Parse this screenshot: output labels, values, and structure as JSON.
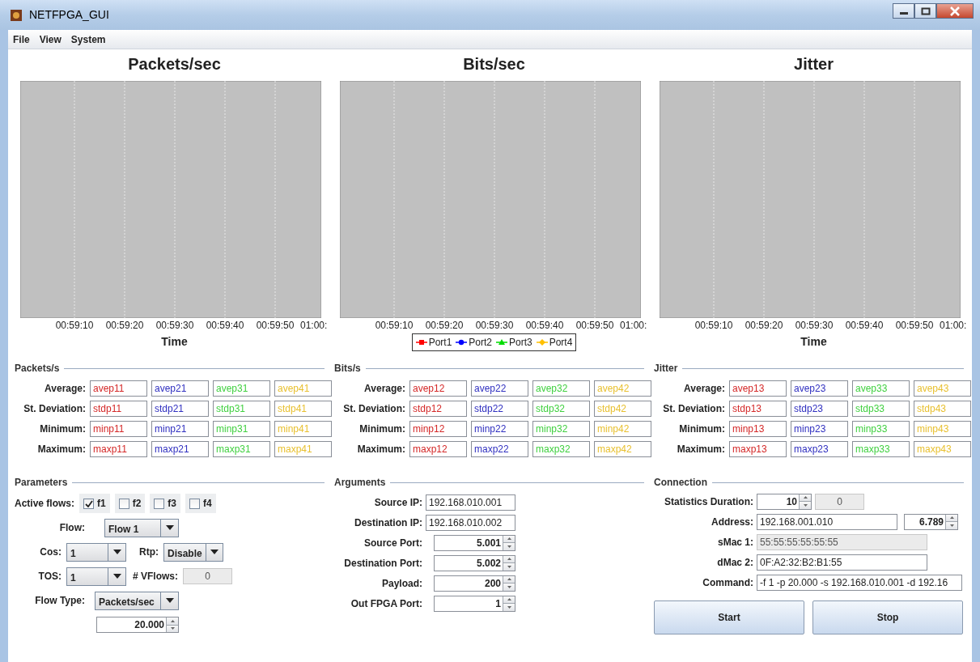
{
  "window": {
    "title": "NETFPGA_GUI"
  },
  "menu": [
    "File",
    "View",
    "System"
  ],
  "charts": [
    {
      "title": "Packets/sec",
      "ticks": [
        "00:59:10",
        "00:59:20",
        "00:59:30",
        "00:59:40",
        "00:59:50",
        "01:00:"
      ],
      "xlabel": "Time"
    },
    {
      "title": "Bits/sec",
      "ticks": [
        "00:59:10",
        "00:59:20",
        "00:59:30",
        "00:59:40",
        "00:59:50",
        "01:00:"
      ],
      "legend": [
        {
          "label": "Port1",
          "color": "#ff0000",
          "kind": "square"
        },
        {
          "label": "Port2",
          "color": "#0000ff",
          "kind": "circle"
        },
        {
          "label": "Port3",
          "color": "#00dd00",
          "kind": "triangle"
        },
        {
          "label": "Port4",
          "color": "#ffc000",
          "kind": "diamond"
        }
      ]
    },
    {
      "title": "Jitter",
      "ticks": [
        "00:59:10",
        "00:59:20",
        "00:59:30",
        "00:59:40",
        "00:59:50",
        "01:00:"
      ],
      "xlabel": "Time"
    }
  ],
  "stats": [
    {
      "title": "Packets/s",
      "rows": [
        {
          "label": "Average:",
          "cells": [
            {
              "text": "avep11",
              "color": "#d42828"
            },
            {
              "text": "avep21",
              "color": "#3030c0"
            },
            {
              "text": "avep31",
              "color": "#40d040"
            },
            {
              "text": "avep41",
              "color": "#e8c030"
            }
          ]
        },
        {
          "label": "St. Deviation:",
          "cells": [
            {
              "text": "stdp11",
              "color": "#d42828"
            },
            {
              "text": "stdp21",
              "color": "#3030c0"
            },
            {
              "text": "stdp31",
              "color": "#40d040"
            },
            {
              "text": "stdp41",
              "color": "#e8c030"
            }
          ]
        },
        {
          "label": "Minimum:",
          "cells": [
            {
              "text": "minp11",
              "color": "#d42828"
            },
            {
              "text": "minp21",
              "color": "#3030c0"
            },
            {
              "text": "minp31",
              "color": "#40d040"
            },
            {
              "text": "minp41",
              "color": "#e8c030"
            }
          ]
        },
        {
          "label": "Maximum:",
          "cells": [
            {
              "text": "maxp11",
              "color": "#d42828"
            },
            {
              "text": "maxp21",
              "color": "#3030c0"
            },
            {
              "text": "maxp31",
              "color": "#40d040"
            },
            {
              "text": "maxp41",
              "color": "#e8c030"
            }
          ]
        }
      ]
    },
    {
      "title": "Bits/s",
      "rows": [
        {
          "label": "Average:",
          "cells": [
            {
              "text": "avep12",
              "color": "#d42828"
            },
            {
              "text": "avep22",
              "color": "#3030c0"
            },
            {
              "text": "avep32",
              "color": "#40d040"
            },
            {
              "text": "avep42",
              "color": "#e8c030"
            }
          ]
        },
        {
          "label": "St. Deviation:",
          "cells": [
            {
              "text": "stdp12",
              "color": "#d42828"
            },
            {
              "text": "stdp22",
              "color": "#3030c0"
            },
            {
              "text": "stdp32",
              "color": "#40d040"
            },
            {
              "text": "stdp42",
              "color": "#e8c030"
            }
          ]
        },
        {
          "label": "Minimum:",
          "cells": [
            {
              "text": "minp12",
              "color": "#d42828"
            },
            {
              "text": "minp22",
              "color": "#3030c0"
            },
            {
              "text": "minp32",
              "color": "#40d040"
            },
            {
              "text": "minp42",
              "color": "#e8c030"
            }
          ]
        },
        {
          "label": "Maximum:",
          "cells": [
            {
              "text": "maxp12",
              "color": "#d42828"
            },
            {
              "text": "maxp22",
              "color": "#3030c0"
            },
            {
              "text": "maxp32",
              "color": "#40d040"
            },
            {
              "text": "maxp42",
              "color": "#e8c030"
            }
          ]
        }
      ]
    },
    {
      "title": "Jitter",
      "rows": [
        {
          "label": "Average:",
          "cells": [
            {
              "text": "avep13",
              "color": "#d42828"
            },
            {
              "text": "avep23",
              "color": "#3030c0"
            },
            {
              "text": "avep33",
              "color": "#40d040"
            },
            {
              "text": "avep43",
              "color": "#e8c030"
            }
          ]
        },
        {
          "label": "St. Deviation:",
          "cells": [
            {
              "text": "stdp13",
              "color": "#d42828"
            },
            {
              "text": "stdp23",
              "color": "#3030c0"
            },
            {
              "text": "stdp33",
              "color": "#40d040"
            },
            {
              "text": "stdp43",
              "color": "#e8c030"
            }
          ]
        },
        {
          "label": "Minimum:",
          "cells": [
            {
              "text": "minp13",
              "color": "#d42828"
            },
            {
              "text": "minp23",
              "color": "#3030c0"
            },
            {
              "text": "minp33",
              "color": "#40d040"
            },
            {
              "text": "minp43",
              "color": "#e8c030"
            }
          ]
        },
        {
          "label": "Maximum:",
          "cells": [
            {
              "text": "maxp13",
              "color": "#d42828"
            },
            {
              "text": "maxp23",
              "color": "#3030c0"
            },
            {
              "text": "maxp33",
              "color": "#40d040"
            },
            {
              "text": "maxp43",
              "color": "#e8c030"
            }
          ]
        }
      ]
    }
  ],
  "parameters": {
    "title": "Parameters",
    "active_flows_label": "Active flows:",
    "flows": [
      {
        "label": "f1",
        "checked": true
      },
      {
        "label": "f2",
        "checked": false
      },
      {
        "label": "f3",
        "checked": false
      },
      {
        "label": "f4",
        "checked": false
      }
    ],
    "flow": {
      "label": "Flow:",
      "value": "Flow 1"
    },
    "cos": {
      "label": "Cos:",
      "value": "1"
    },
    "rtp": {
      "label": "Rtp:",
      "value": "Disable"
    },
    "tos": {
      "label": "TOS:",
      "value": "1"
    },
    "vflows": {
      "label": "# VFlows:",
      "value": "0",
      "disabled": true
    },
    "flow_type": {
      "label": "Flow Type:",
      "value": "Packets/sec"
    },
    "rate": {
      "value": "20.000"
    }
  },
  "arguments": {
    "title": "Arguments",
    "fields": [
      {
        "label": "Source IP:",
        "value": "192.168.010.001",
        "kind": "text"
      },
      {
        "label": "Destination IP:",
        "value": "192.168.010.002",
        "kind": "text"
      },
      {
        "label": "Source Port:",
        "value": "5.001",
        "kind": "spinner"
      },
      {
        "label": "Destination Port:",
        "value": "5.002",
        "kind": "spinner"
      },
      {
        "label": "Payload:",
        "value": "200",
        "kind": "spinner"
      },
      {
        "label": "Out FPGA Port:",
        "value": "1",
        "kind": "spinner"
      }
    ]
  },
  "connection": {
    "title": "Connection",
    "statistics_duration": {
      "label": "Statistics Duration:",
      "value": "10",
      "counter": "0",
      "counter_disabled": true
    },
    "address": {
      "label": "Address:",
      "value": "192.168.001.010",
      "port": "6.789"
    },
    "smac": {
      "label": "sMac 1:",
      "value": "55:55:55:55:55:55",
      "disabled": true
    },
    "dmac": {
      "label": "dMac 2:",
      "value": "0F:A2:32:B2:B1:55",
      "disabled": false
    },
    "command": {
      "label": "Command:",
      "value": "-f 1 -p 20.000 -s 192.168.010.001 -d 192.16"
    },
    "buttons": [
      "Start",
      "Stop"
    ]
  }
}
